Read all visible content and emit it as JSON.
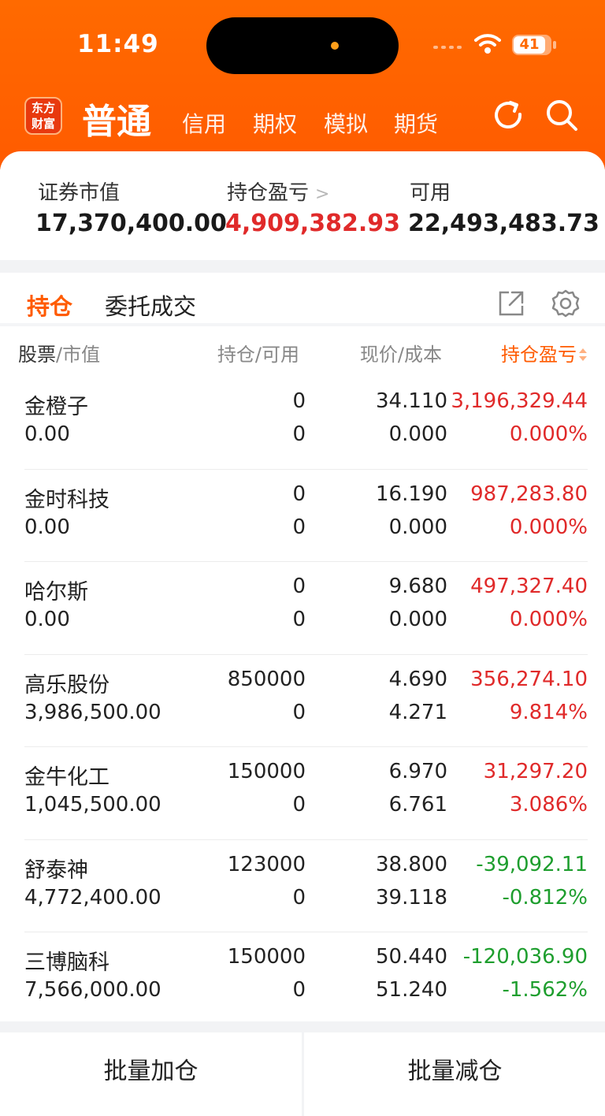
{
  "status_bar": {
    "time": "11:49",
    "battery": "41"
  },
  "nav": {
    "logo": "东方\n财富",
    "logo_line1": "东方",
    "logo_line2": "财富",
    "tabs": [
      {
        "label": "普通",
        "active": true
      },
      {
        "label": "信用",
        "active": false
      },
      {
        "label": "期权",
        "active": false
      },
      {
        "label": "模拟",
        "active": false
      },
      {
        "label": "期货",
        "active": false
      }
    ],
    "icons": [
      "refresh-icon",
      "search-icon"
    ]
  },
  "summary": {
    "market_value_label": "证券市值",
    "market_value": "17,370,400.00",
    "pnl_label": "持仓盈亏",
    "pnl_value": "4,909,382.93",
    "available_label": "可用",
    "available_value": "22,493,483.73"
  },
  "subtabs": {
    "positions": "持仓",
    "orders": "委托成交"
  },
  "table_header": {
    "col1_a": "股票",
    "col1_b": "/市值",
    "col2": "持仓/可用",
    "col3": "现价/成本",
    "col4": "持仓盈亏"
  },
  "positions": [
    {
      "name": "金橙子",
      "market_value": "0.00",
      "holding": "0",
      "available": "0",
      "price": "34.110",
      "cost": "0.000",
      "pnl": "3,196,329.44",
      "pnl_pct": "0.000%",
      "trend": "up"
    },
    {
      "name": "金时科技",
      "market_value": "0.00",
      "holding": "0",
      "available": "0",
      "price": "16.190",
      "cost": "0.000",
      "pnl": "987,283.80",
      "pnl_pct": "0.000%",
      "trend": "up"
    },
    {
      "name": "哈尔斯",
      "market_value": "0.00",
      "holding": "0",
      "available": "0",
      "price": "9.680",
      "cost": "0.000",
      "pnl": "497,327.40",
      "pnl_pct": "0.000%",
      "trend": "up"
    },
    {
      "name": "高乐股份",
      "market_value": "3,986,500.00",
      "holding": "850000",
      "available": "0",
      "price": "4.690",
      "cost": "4.271",
      "pnl": "356,274.10",
      "pnl_pct": "9.814%",
      "trend": "up"
    },
    {
      "name": "金牛化工",
      "market_value": "1,045,500.00",
      "holding": "150000",
      "available": "0",
      "price": "6.970",
      "cost": "6.761",
      "pnl": "31,297.20",
      "pnl_pct": "3.086%",
      "trend": "up"
    },
    {
      "name": "舒泰神",
      "market_value": "4,772,400.00",
      "holding": "123000",
      "available": "0",
      "price": "38.800",
      "cost": "39.118",
      "pnl": "-39,092.11",
      "pnl_pct": "-0.812%",
      "trend": "down"
    },
    {
      "name": "三博脑科",
      "market_value": "7,566,000.00",
      "holding": "150000",
      "available": "0",
      "price": "50.440",
      "cost": "51.240",
      "pnl": "-120,036.90",
      "pnl_pct": "-1.562%",
      "trend": "down"
    }
  ],
  "bottom_actions": {
    "add": "批量加仓",
    "reduce": "批量减仓"
  },
  "colors": {
    "brand": "#ff5b00",
    "up": "#e02a2a",
    "down": "#1e9e2e"
  }
}
